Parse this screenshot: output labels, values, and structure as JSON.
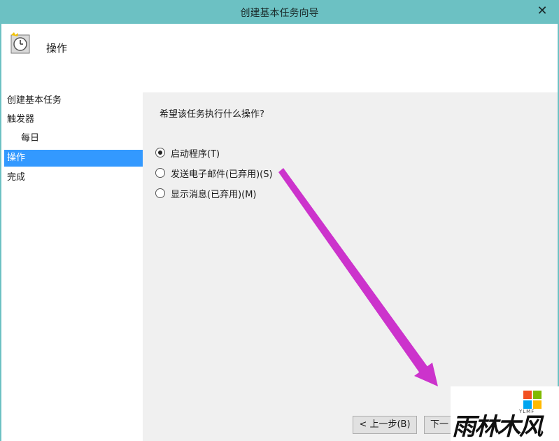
{
  "window": {
    "title": "创建基本任务向导",
    "close_glyph": "✕"
  },
  "header": {
    "heading": "操作"
  },
  "nav": {
    "items": [
      {
        "label": "创建基本任务"
      },
      {
        "label": "触发器"
      },
      {
        "label": "每日"
      },
      {
        "label": "操作",
        "active": true
      },
      {
        "label": "完成"
      }
    ]
  },
  "content": {
    "question": "希望该任务执行什么操作?",
    "options": [
      {
        "label": "启动程序(T)",
        "checked": true
      },
      {
        "label": "发送电子邮件(已弃用)(S)",
        "checked": false
      },
      {
        "label": "显示消息(已弃用)(M)",
        "checked": false
      }
    ]
  },
  "buttons": {
    "back": "< 上一步(B)",
    "next": "下一"
  },
  "watermark": {
    "brand": "雨林木风",
    "sub": "YLMF"
  },
  "colors": {
    "titlebar": "#6cc1c3",
    "selection": "#3399ff",
    "arrow": "#cc33cc"
  }
}
